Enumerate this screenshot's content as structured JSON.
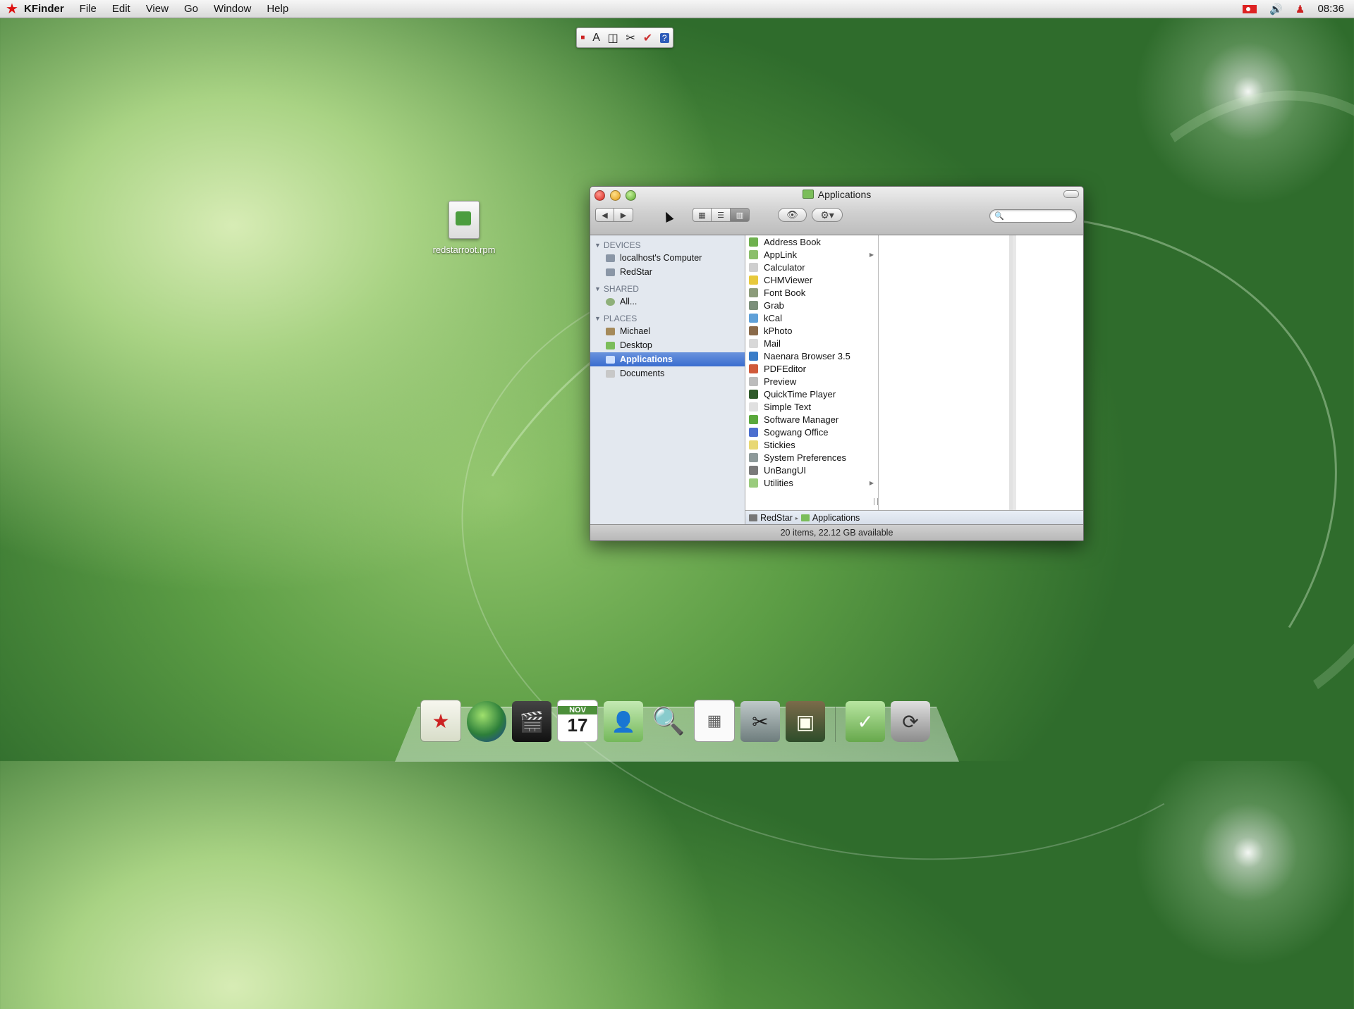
{
  "menubar": {
    "app_name": "KFinder",
    "menus": [
      "File",
      "Edit",
      "View",
      "Go",
      "Window",
      "Help"
    ],
    "clock": "08:36"
  },
  "desktop": {
    "file_label": "redstarroot.rpm"
  },
  "window": {
    "title": "Applications",
    "search_placeholder": "",
    "sidebar": {
      "sections": [
        {
          "title": "DEVICES",
          "items": [
            "localhost's Computer",
            "RedStar"
          ]
        },
        {
          "title": "SHARED",
          "items": [
            "All..."
          ]
        },
        {
          "title": "PLACES",
          "items": [
            "Michael",
            "Desktop",
            "Applications",
            "Documents"
          ]
        }
      ],
      "selected": "Applications"
    },
    "apps": [
      {
        "name": "Address Book",
        "color": "#6fb14f"
      },
      {
        "name": "AppLink",
        "color": "#8bbf6b",
        "folder": true
      },
      {
        "name": "Calculator",
        "color": "#cfcfcf"
      },
      {
        "name": "CHMViewer",
        "color": "#e7c93c"
      },
      {
        "name": "Font Book",
        "color": "#8c9c7a"
      },
      {
        "name": "Grab",
        "color": "#7b8f7a"
      },
      {
        "name": "kCal",
        "color": "#5fa0d8"
      },
      {
        "name": "kPhoto",
        "color": "#8a6a4a"
      },
      {
        "name": "Mail",
        "color": "#d8d8d8"
      },
      {
        "name": "Naenara Browser 3.5",
        "color": "#3a7dc8"
      },
      {
        "name": "PDFEditor",
        "color": "#d05a3a"
      },
      {
        "name": "Preview",
        "color": "#bcbcbc"
      },
      {
        "name": "QuickTime Player",
        "color": "#2f5a2a"
      },
      {
        "name": "Simple Text",
        "color": "#e0e0e0"
      },
      {
        "name": "Software Manager",
        "color": "#5aa83c"
      },
      {
        "name": "Sogwang Office",
        "color": "#4c6fcf"
      },
      {
        "name": "Stickies",
        "color": "#e8d873"
      },
      {
        "name": "System Preferences",
        "color": "#8e9a9a"
      },
      {
        "name": "UnBangUI",
        "color": "#7a7a7a"
      },
      {
        "name": "Utilities",
        "color": "#9acb7d",
        "folder": true
      }
    ],
    "path": [
      "RedStar",
      "Applications"
    ],
    "status": "20 items, 22.12 GB available"
  },
  "dock": {
    "calendar_month": "NOV",
    "calendar_day": "17"
  }
}
